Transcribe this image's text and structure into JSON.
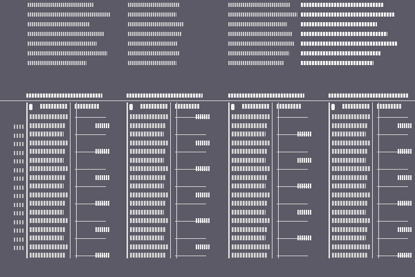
{
  "theme": {
    "background": "#5b5a66",
    "text": "#e6e6e6",
    "rule": "#cfcfcf"
  },
  "note": "",
  "top_columns": [
    {
      "id": "col1",
      "rows": 7
    },
    {
      "id": "col2",
      "rows": 7
    },
    {
      "id": "col3",
      "rows": 7
    },
    {
      "id": "col4",
      "rows": 7
    }
  ],
  "panels": [
    {
      "id": "panel1",
      "rows": 17
    },
    {
      "id": "panel2",
      "rows": 17
    },
    {
      "id": "panel3",
      "rows": 17
    },
    {
      "id": "panel4",
      "rows": 17
    }
  ]
}
